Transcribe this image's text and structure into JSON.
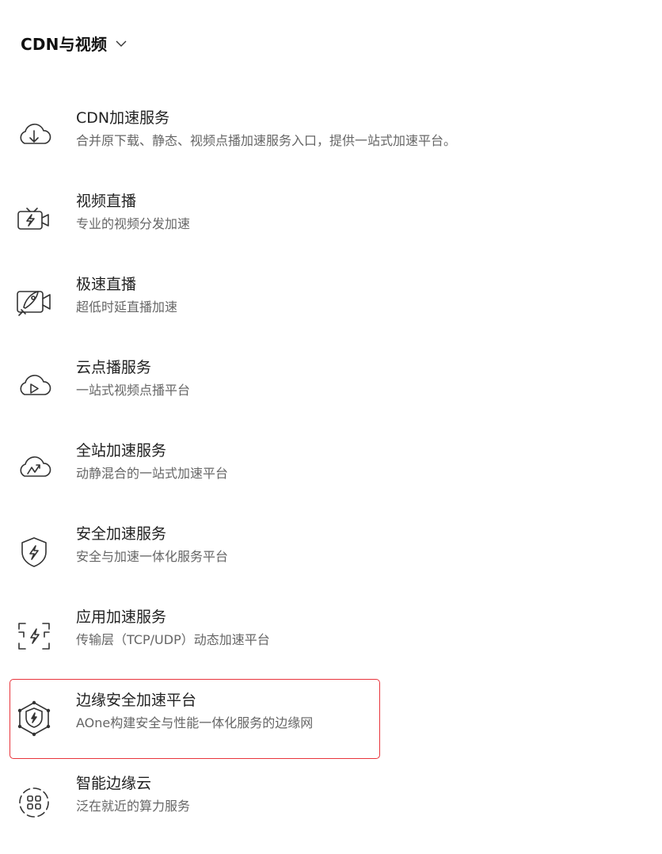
{
  "header": {
    "title": "CDN与视频"
  },
  "items": [
    {
      "title": "CDN加速服务",
      "desc": "合并原下载、静态、视频点播加速服务入口，提供一站式加速平台。",
      "icon": "cloud-download-icon"
    },
    {
      "title": "视频直播",
      "desc": "专业的视频分发加速",
      "icon": "tv-camera-icon"
    },
    {
      "title": "极速直播",
      "desc": "超低时延直播加速",
      "icon": "rocket-camera-icon"
    },
    {
      "title": "云点播服务",
      "desc": "一站式视频点播平台",
      "icon": "cloud-play-icon"
    },
    {
      "title": "全站加速服务",
      "desc": "动静混合的一站式加速平台",
      "icon": "cloud-bolt-icon"
    },
    {
      "title": "安全加速服务",
      "desc": "安全与加速一体化服务平台",
      "icon": "shield-bolt-icon"
    },
    {
      "title": "应用加速服务",
      "desc": "传输层（TCP/UDP）动态加速平台",
      "icon": "scan-bolt-icon"
    },
    {
      "title": "边缘安全加速平台",
      "desc": "AOne构建安全与性能一体化服务的边缘网",
      "icon": "edge-shield-icon"
    },
    {
      "title": "智能边缘云",
      "desc": "泛在就近的算力服务",
      "icon": "edge-grid-icon"
    }
  ],
  "selected_item": "边缘安全加速平台",
  "colors": {
    "highlight": "#e8343b",
    "icon_stroke": "#333333",
    "desc_text": "#666666"
  }
}
